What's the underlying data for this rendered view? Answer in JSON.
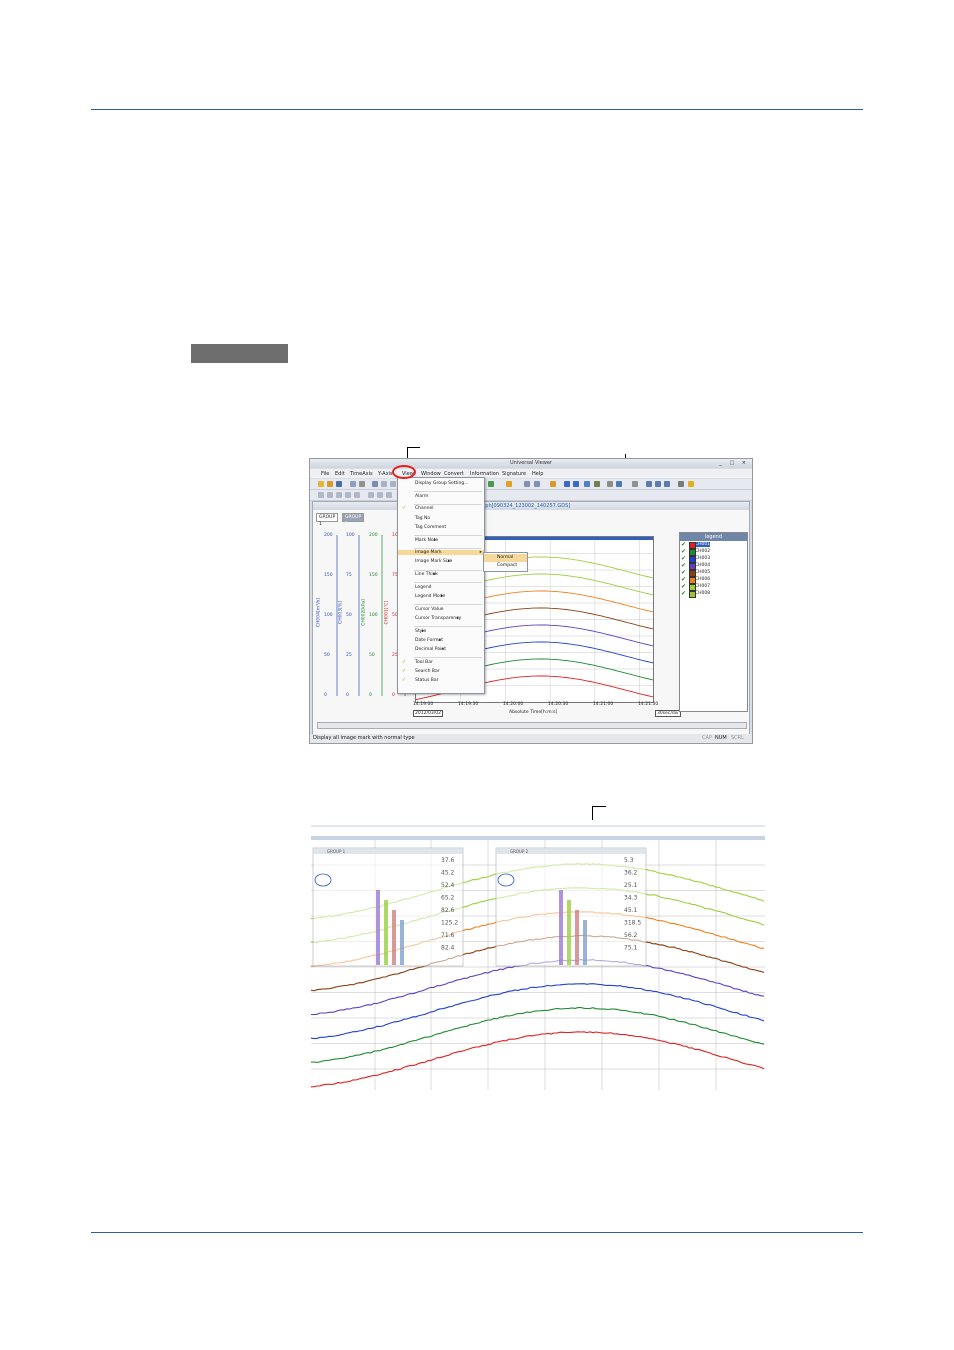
{
  "window": {
    "title": "Universal Viewer",
    "controls": "_ □ ×",
    "menus": [
      "File",
      "Edit",
      "TimeAxis",
      "Y-Axis",
      "View",
      "Window",
      "Convert",
      "Information",
      "Signature",
      "Help"
    ]
  },
  "view_menu": {
    "items": [
      {
        "label": "Display Group Setting..."
      },
      {
        "label": "Alarm"
      },
      {
        "label": "Channel",
        "checked": true
      },
      {
        "label": "Tag No"
      },
      {
        "label": "Tag Comment"
      },
      {
        "label": "Mark Note",
        "submenu": true
      },
      {
        "label": "Image Mark",
        "submenu": true,
        "highlighted": true
      },
      {
        "label": "Image Mark Size",
        "submenu": true
      },
      {
        "label": "Line Thick",
        "submenu": true
      },
      {
        "label": "Legend"
      },
      {
        "label": "Legend Mode",
        "submenu": true
      },
      {
        "label": "Cursor Value"
      },
      {
        "label": "Cursor Transparency",
        "submenu": true
      },
      {
        "label": "Style",
        "submenu": true
      },
      {
        "label": "Date Format",
        "submenu": true
      },
      {
        "label": "Decimal Point",
        "submenu": true
      },
      {
        "label": "Tool Bar",
        "checked": true
      },
      {
        "label": "Search Bar",
        "checked": true
      },
      {
        "label": "Status Bar",
        "checked": true
      }
    ],
    "arrow": "▸",
    "check": "✓"
  },
  "image_mark_submenu": [
    "Normal",
    "Compact"
  ],
  "doc": {
    "title": "Trend Graph[090324_123002_140257.GDS]",
    "tabs": [
      "GROUP 1",
      "GROUP 2"
    ]
  },
  "axes": {
    "left_axes": [
      {
        "label": "CH004[m³/h]",
        "color": "#2f4fb8",
        "ticks": [
          "200",
          "150",
          "100",
          "50",
          "0"
        ]
      },
      {
        "label": "CH003[%]",
        "color": "#2f4fb8",
        "ticks": [
          "100",
          "75",
          "50",
          "25",
          "0"
        ]
      },
      {
        "label": "CH002[kPa]",
        "color": "#1b8a2a",
        "ticks": [
          "200",
          "150",
          "100",
          "50",
          "0"
        ]
      },
      {
        "label": "CH001[℃]",
        "color": "#d02020",
        "ticks": [
          "100",
          "75",
          "50",
          "25",
          "0"
        ]
      }
    ],
    "time_ticks": [
      "14:19:00",
      "14:19:30",
      "14:20:00",
      "14:20:30",
      "14:21:00",
      "14:21:30"
    ],
    "date_label": "2012/03/02",
    "xlabel": "Absolute Time[h:m:s]",
    "div_label": "30sec/div"
  },
  "legend": {
    "title": "legend",
    "items": [
      {
        "name": "CH001",
        "color": "#e02020",
        "selected": true
      },
      {
        "name": "CH002",
        "color": "#208a30"
      },
      {
        "name": "CH003",
        "color": "#2040d0"
      },
      {
        "name": "CH004",
        "color": "#6040c0"
      },
      {
        "name": "CH005",
        "color": "#8a4010"
      },
      {
        "name": "CH006",
        "color": "#f08020"
      },
      {
        "name": "CH007",
        "color": "#9ad040"
      },
      {
        "name": "CH008",
        "color": "#a0c030"
      }
    ],
    "check": "✔"
  },
  "status": {
    "message": "Display all image mark with normal type",
    "indicators": [
      "CAP",
      "NUM",
      "SCRL"
    ]
  },
  "series_colors": [
    "#e02020",
    "#208a30",
    "#2040d0",
    "#6040c0",
    "#8a4010",
    "#f08020",
    "#9ad040",
    "#a0d040"
  ],
  "image_mark": {
    "values_left": [
      "37.6",
      "45.2",
      "52.4",
      "65.2",
      "82.6",
      "125.2",
      "71.6",
      "82.4"
    ],
    "values_right": [
      "5.3",
      "36.2",
      "25.1",
      "34.3",
      "45.1",
      "318.5",
      "56.2",
      "75.1"
    ],
    "title_left": "GROUP 1",
    "title_right": "GROUP 2"
  }
}
